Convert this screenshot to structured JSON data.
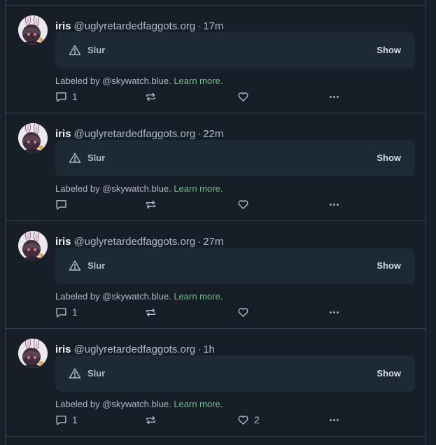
{
  "posts": [
    {
      "author_name": "iris",
      "author_handle": "@uglyretardedfaggots.org",
      "separator": "·",
      "time": "17m",
      "label": {
        "text": "Slur",
        "show_label": "Show",
        "icon": "warning-triangle-icon"
      },
      "labeled_by_prefix": "Labeled by @skywatch.blue.",
      "learn_more": "Learn more.",
      "reply_count": "1",
      "repost_count": "",
      "like_count": ""
    },
    {
      "author_name": "iris",
      "author_handle": "@uglyretardedfaggots.org",
      "separator": "·",
      "time": "22m",
      "label": {
        "text": "Slur",
        "show_label": "Show",
        "icon": "warning-triangle-icon"
      },
      "labeled_by_prefix": "Labeled by @skywatch.blue.",
      "learn_more": "Learn more.",
      "reply_count": "",
      "repost_count": "",
      "like_count": ""
    },
    {
      "author_name": "iris",
      "author_handle": "@uglyretardedfaggots.org",
      "separator": "·",
      "time": "27m",
      "label": {
        "text": "Slur",
        "show_label": "Show",
        "icon": "warning-triangle-icon"
      },
      "labeled_by_prefix": "Labeled by @skywatch.blue.",
      "learn_more": "Learn more.",
      "reply_count": "1",
      "repost_count": "",
      "like_count": ""
    },
    {
      "author_name": "iris",
      "author_handle": "@uglyretardedfaggots.org",
      "separator": "·",
      "time": "1h",
      "label": {
        "text": "Slur",
        "show_label": "Show",
        "icon": "warning-triangle-icon"
      },
      "labeled_by_prefix": "Labeled by @skywatch.blue.",
      "learn_more": "Learn more.",
      "reply_count": "1",
      "repost_count": "",
      "like_count": "2"
    }
  ],
  "colors": {
    "background": "#161e27",
    "card": "#1e2936",
    "border": "#2e4052",
    "muted_text": "#aebbc9",
    "link": "#6fbf8a"
  },
  "icons": [
    "reply-icon",
    "repost-icon",
    "like-icon",
    "more-options-icon",
    "warning-triangle-icon"
  ]
}
